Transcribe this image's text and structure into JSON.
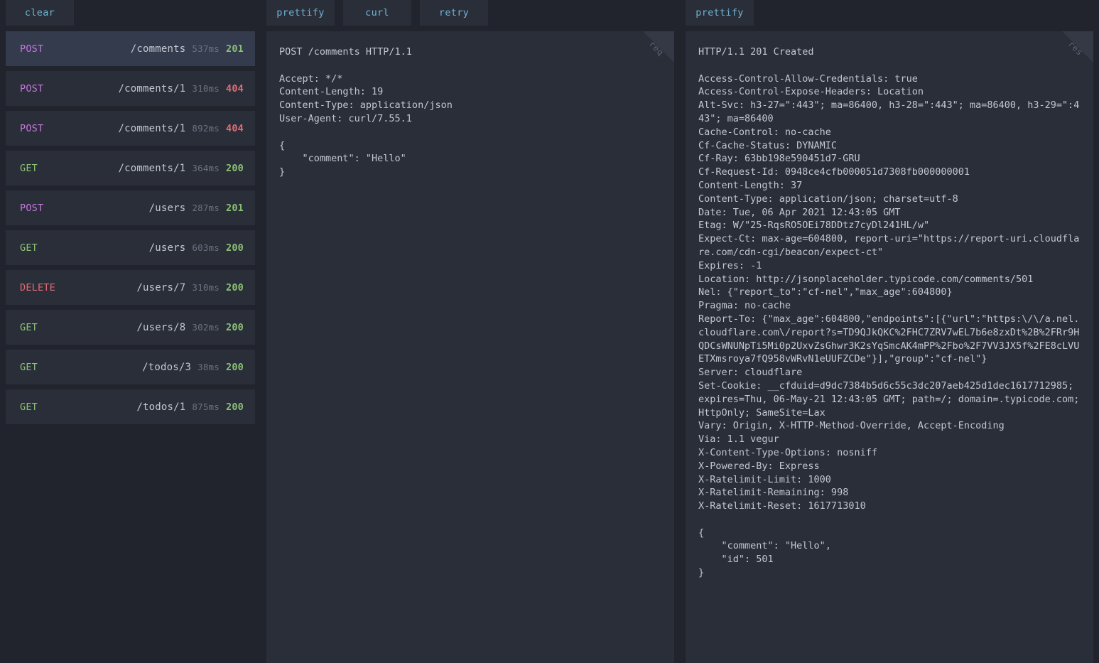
{
  "sidebar": {
    "clear_label": "clear",
    "columns": [
      "method",
      "path",
      "time",
      "status"
    ],
    "requests": [
      {
        "method": "POST",
        "path": "/comments",
        "time": "537ms",
        "status": "201",
        "selected": true
      },
      {
        "method": "POST",
        "path": "/comments/1",
        "time": "310ms",
        "status": "404",
        "selected": false
      },
      {
        "method": "POST",
        "path": "/comments/1",
        "time": "892ms",
        "status": "404",
        "selected": false
      },
      {
        "method": "GET",
        "path": "/comments/1",
        "time": "364ms",
        "status": "200",
        "selected": false
      },
      {
        "method": "POST",
        "path": "/users",
        "time": "287ms",
        "status": "201",
        "selected": false
      },
      {
        "method": "GET",
        "path": "/users",
        "time": "603ms",
        "status": "200",
        "selected": false
      },
      {
        "method": "DELETE",
        "path": "/users/7",
        "time": "310ms",
        "status": "200",
        "selected": false
      },
      {
        "method": "GET",
        "path": "/users/8",
        "time": "302ms",
        "status": "200",
        "selected": false
      },
      {
        "method": "GET",
        "path": "/todos/3",
        "time": "38ms",
        "status": "200",
        "selected": false
      },
      {
        "method": "GET",
        "path": "/todos/1",
        "time": "875ms",
        "status": "200",
        "selected": false
      }
    ]
  },
  "request_pane": {
    "buttons": {
      "prettify": "prettify",
      "curl": "curl",
      "retry": "retry"
    },
    "corner_label": "req",
    "content": "POST /comments HTTP/1.1\n\nAccept: */*\nContent-Length: 19\nContent-Type: application/json\nUser-Agent: curl/7.55.1\n\n{\n    \"comment\": \"Hello\"\n}"
  },
  "response_pane": {
    "buttons": {
      "prettify": "prettify"
    },
    "corner_label": "res",
    "content": "HTTP/1.1 201 Created\n\nAccess-Control-Allow-Credentials: true\nAccess-Control-Expose-Headers: Location\nAlt-Svc: h3-27=\":443\"; ma=86400, h3-28=\":443\"; ma=86400, h3-29=\":443\"; ma=86400\nCache-Control: no-cache\nCf-Cache-Status: DYNAMIC\nCf-Ray: 63bb198e590451d7-GRU\nCf-Request-Id: 0948ce4cfb000051d7308fb000000001\nContent-Length: 37\nContent-Type: application/json; charset=utf-8\nDate: Tue, 06 Apr 2021 12:43:05 GMT\nEtag: W/\"25-RqsRO5OEi78DDtz7cyDl241HL/w\"\nExpect-Ct: max-age=604800, report-uri=\"https://report-uri.cloudflare.com/cdn-cgi/beacon/expect-ct\"\nExpires: -1\nLocation: http://jsonplaceholder.typicode.com/comments/501\nNel: {\"report_to\":\"cf-nel\",\"max_age\":604800}\nPragma: no-cache\nReport-To: {\"max_age\":604800,\"endpoints\":[{\"url\":\"https:\\/\\/a.nel.cloudflare.com\\/report?s=TD9QJkQKC%2FHC7ZRV7wEL7b6e8zxDt%2B%2FRr9HQDCsWNUNpTi5Mi0p2UxvZsGhwr3K2sYqSmcAK4mPP%2Fbo%2F7VV3JX5f%2FE8cLVUETXmsroya7fQ958vWRvN1eUUFZCDe\"}],\"group\":\"cf-nel\"}\nServer: cloudflare\nSet-Cookie: __cfduid=d9dc7384b5d6c55c3dc207aeb425d1dec1617712985; expires=Thu, 06-May-21 12:43:05 GMT; path=/; domain=.typicode.com; HttpOnly; SameSite=Lax\nVary: Origin, X-HTTP-Method-Override, Accept-Encoding\nVia: 1.1 vegur\nX-Content-Type-Options: nosniff\nX-Powered-By: Express\nX-Ratelimit-Limit: 1000\nX-Ratelimit-Remaining: 998\nX-Ratelimit-Reset: 1617713010\n\n{\n    \"comment\": \"Hello\",\n    \"id\": 501\n}"
  },
  "colors": {
    "background": "#21242c",
    "panel": "#2a2e39",
    "selected_row": "#343b4d",
    "accent_link": "#6fb3d2",
    "method_get": "#8ac176",
    "method_post": "#c678dd",
    "method_delete": "#e06c75",
    "status_ok": "#8ac176",
    "status_error": "#e06c75",
    "text": "#c2c7d0",
    "muted": "#6b7180"
  }
}
